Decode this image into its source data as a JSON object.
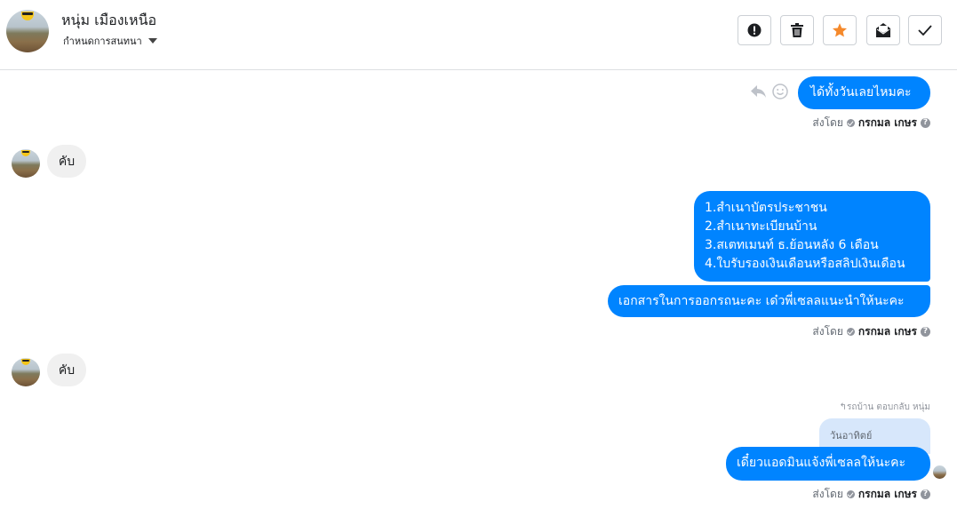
{
  "header": {
    "contact_name": "หนุ่ม เมืองเหนือ",
    "assign_label": "กำหนดการสนทนา",
    "buttons": [
      {
        "icon": "alert-icon"
      },
      {
        "icon": "trash-icon"
      },
      {
        "icon": "star-icon",
        "color": "#f5892b"
      },
      {
        "icon": "mail-icon"
      },
      {
        "icon": "check-icon"
      }
    ]
  },
  "messages": {
    "msg1": "ได้ทั้งวันเลยไหมคะ",
    "reply1": "คับ",
    "msg2_lines": [
      "1.สำเนาบัตรประชาชน",
      "2.สำเนาทะเบียนบ้าน",
      "3.สเตทเมนท์ ธ.ย้อนหลัง 6 เดือน",
      "4.ใบรับรองเงินเดือนหรือสลิปเงินเดือน"
    ],
    "msg3": "เอกสารในการออกรถนะคะ เด๋วพี่เซลลแนะนำให้นะคะ",
    "reply2": "คับ",
    "reply_meta": "↰รถบ้าน ตอบกลับ หนุ่ม",
    "quoted": "วันอาทิตย์",
    "msg4": "เดี๋ยวแอดมินแจ้งพี่เซลลให้นะคะ"
  },
  "sent_by": {
    "prefix": "ส่งโดย",
    "name": "กรกมล เกษร",
    "help": "?"
  },
  "colors": {
    "outgoing": "#0084ff",
    "incoming": "#f0f0f0",
    "star": "#f5892b"
  }
}
